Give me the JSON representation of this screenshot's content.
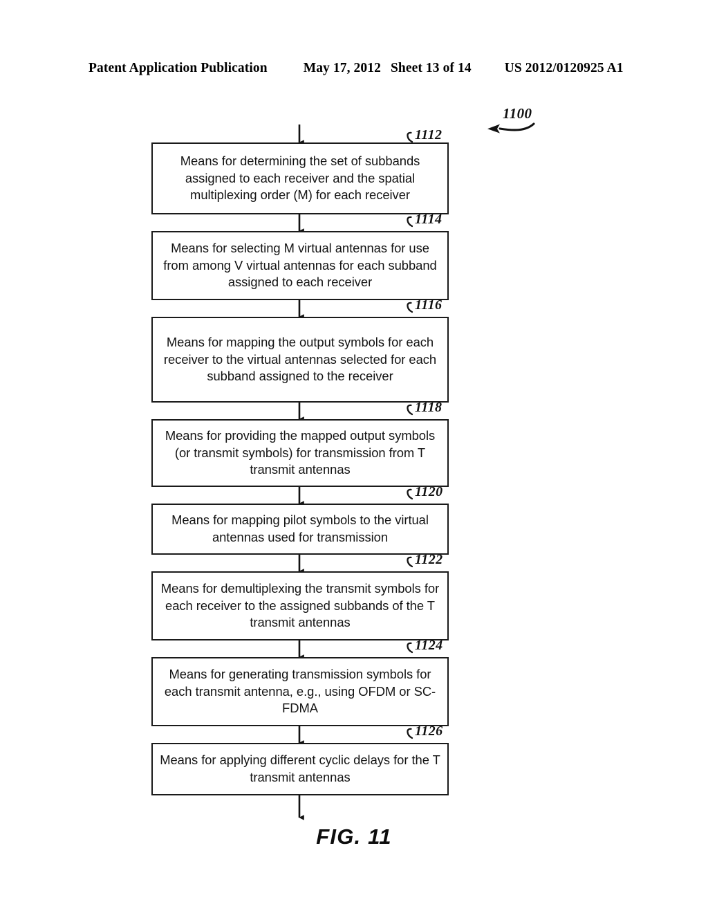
{
  "header": {
    "title": "Patent Application Publication",
    "date": "May 17, 2012",
    "sheet": "Sheet 13 of 14",
    "publication_number": "US 2012/0120925 A1"
  },
  "figure": {
    "caption": "FIG. 11",
    "main_reference": "1100"
  },
  "flow": {
    "steps": [
      {
        "ref": "1112",
        "text": "Means for determining the set of subbands assigned to each receiver and the spatial multiplexing order (M) for each receiver",
        "lines": 3
      },
      {
        "ref": "1114",
        "text": "Means for selecting M virtual antennas for use from among V virtual antennas for each subband assigned to each receiver",
        "lines": 3
      },
      {
        "ref": "1116",
        "text": "Means for mapping the output symbols for each receiver to the virtual antennas selected for each subband assigned to the receiver",
        "lines": 4
      },
      {
        "ref": "1118",
        "text": "Means for providing the mapped output symbols (or transmit symbols) for transmission from T transmit antennas",
        "lines": 3
      },
      {
        "ref": "1120",
        "text": "Means for mapping pilot symbols to the virtual antennas used for transmission",
        "lines": 2
      },
      {
        "ref": "1122",
        "text": "Means for demultiplexing the transmit symbols for each receiver to the assigned subbands of the T transmit antennas",
        "lines": 3
      },
      {
        "ref": "1124",
        "text": "Means for generating transmission symbols for each transmit antenna, e.g., using OFDM or SC-FDMA",
        "lines": 3
      },
      {
        "ref": "1126",
        "text": "Means for applying different cyclic delays for the T transmit antennas",
        "lines": 2
      }
    ]
  },
  "colors": {
    "ink": "#111111",
    "paper": "#ffffff"
  }
}
